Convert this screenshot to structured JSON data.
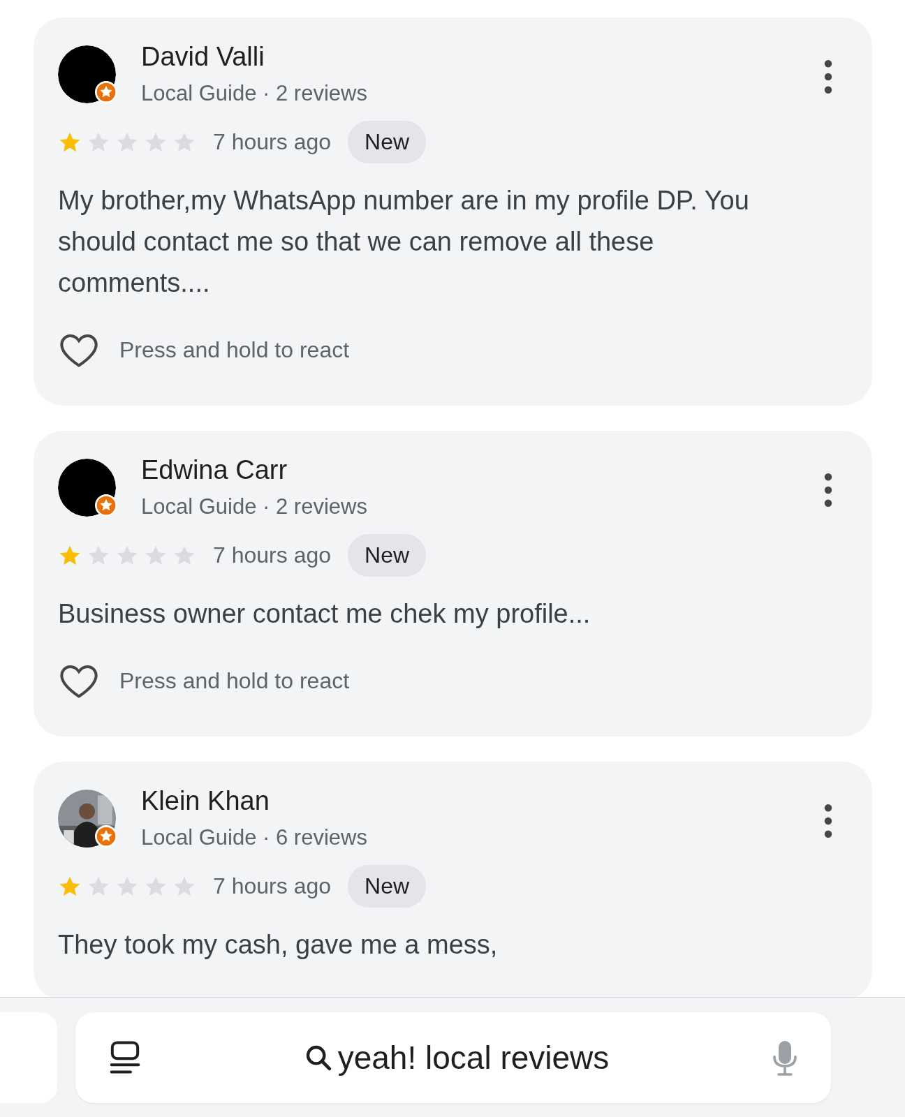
{
  "reviews": [
    {
      "name": "David Valli",
      "kind": "dark",
      "meta": "Local Guide · 2 reviews",
      "stars": 1,
      "time": "7 hours ago",
      "badge": "New",
      "text": "My brother,my WhatsApp number are in my profile DP. You should contact me so that we can remove all these comments....",
      "react": "Press and hold to react"
    },
    {
      "name": "Edwina Carr",
      "kind": "dark",
      "meta": "Local Guide · 2 reviews",
      "stars": 1,
      "time": "7 hours ago",
      "badge": "New",
      "text": "Business owner contact me chek my profile...",
      "react": "Press and hold to react"
    },
    {
      "name": "Klein Khan",
      "kind": "photo",
      "meta": "Local Guide · 6 reviews",
      "stars": 1,
      "time": "7 hours ago",
      "badge": "New",
      "text": "They took my cash, gave me a mess,"
    }
  ],
  "search_bar": {
    "query": "yeah! local reviews"
  }
}
